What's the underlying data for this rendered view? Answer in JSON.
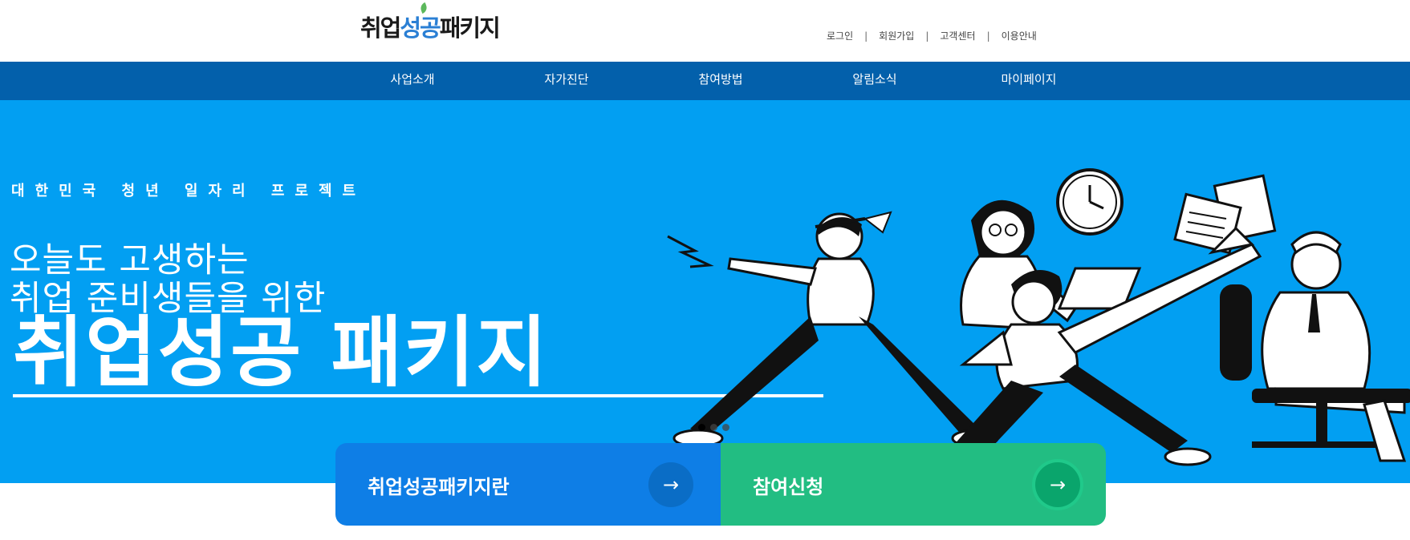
{
  "header": {
    "logo": {
      "part1": "취업",
      "part2": "성공",
      "part3": "패키지"
    },
    "util_links": [
      "로그인",
      "회원가입",
      "고객센터",
      "이용안내"
    ],
    "separator": "|"
  },
  "gnb": {
    "items": [
      "사업소개",
      "자가진단",
      "참여방법",
      "알림소식",
      "마이페이지"
    ]
  },
  "hero": {
    "kicker": "대한민국 청년 일자리 프로젝트",
    "line1": "오늘도 고생하는",
    "line2": "취업 준비생들을 위한",
    "headline": "취업성공 패키지",
    "slide_count": 3,
    "active_slide": 1
  },
  "cta": {
    "left": {
      "label": "취업성공패키지란",
      "icon": "arrow-right-icon",
      "arrow": "→",
      "color": "#0e7ee6"
    },
    "right": {
      "label": "참여신청",
      "icon": "arrow-right-icon",
      "arrow": "→",
      "color": "#22bd82"
    }
  },
  "colors": {
    "gnb": "#0360ab",
    "hero_bg": "#029ff2"
  }
}
